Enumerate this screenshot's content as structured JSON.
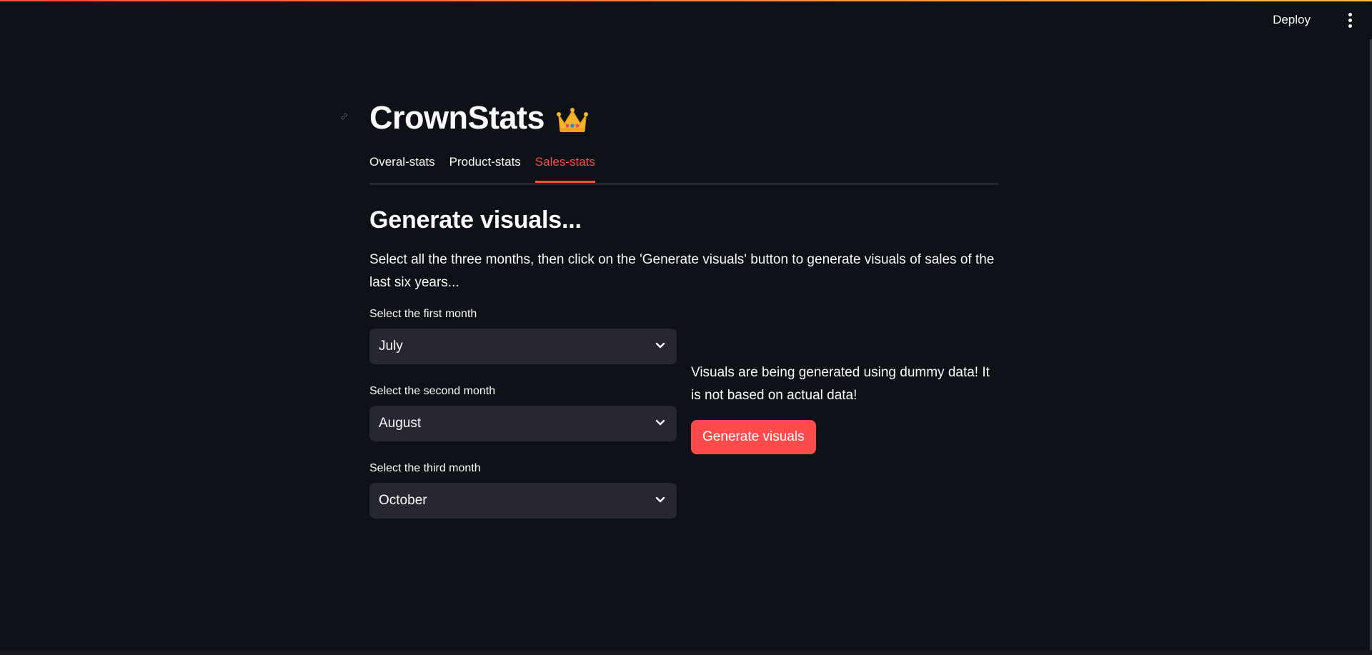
{
  "app": {
    "title": "CrownStats",
    "deploy_label": "Deploy"
  },
  "tabs": [
    {
      "label": "Overal-stats",
      "active": false
    },
    {
      "label": "Product-stats",
      "active": false
    },
    {
      "label": "Sales-stats",
      "active": true
    }
  ],
  "section": {
    "heading": "Generate visuals...",
    "description": "Select all the three months, then click on the 'Generate visuals' button to generate visuals of sales of the last six years..."
  },
  "selects": [
    {
      "label": "Select the first month",
      "value": "July"
    },
    {
      "label": "Select the second month",
      "value": "August"
    },
    {
      "label": "Select the third month",
      "value": "October"
    }
  ],
  "notice": {
    "text": "Visuals are being generated using dummy data! It is not based on actual data!"
  },
  "button": {
    "label": "Generate visuals"
  },
  "colors": {
    "background": "#0e1117",
    "accent": "#ff4b4b",
    "select_bg": "#262730",
    "text": "#fafafa"
  },
  "icons": {
    "title_emoji": "crown-icon",
    "menu": "kebab-menu-icon",
    "select_caret": "chevron-down-icon",
    "anchor": "link-icon"
  }
}
